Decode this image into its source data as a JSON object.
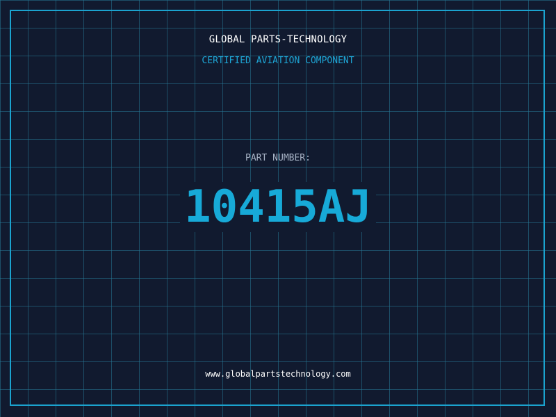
{
  "header": {
    "company": "GLOBAL PARTS-TECHNOLOGY",
    "subtitle": "CERTIFIED AVIATION COMPONENT"
  },
  "part": {
    "label": "PART NUMBER:",
    "number": "10415AJ"
  },
  "footer": {
    "url": "www.globalpartstechnology.com"
  },
  "colors": {
    "background": "#111a2f",
    "grid": "#26788f",
    "frame": "#1ba3cf",
    "accent": "#17aad8",
    "label": "#a8b4c6",
    "text": "#ffffff"
  }
}
